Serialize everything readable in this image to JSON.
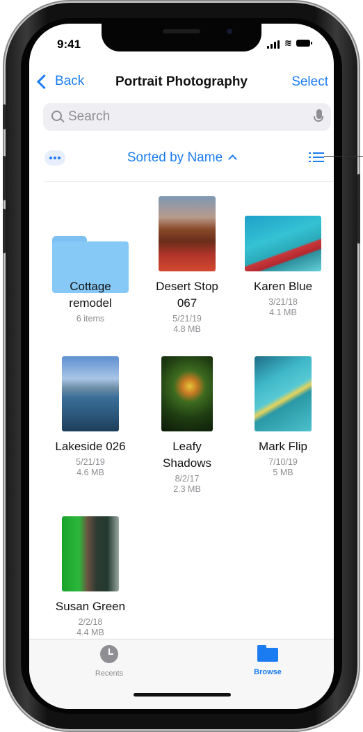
{
  "status_bar": {
    "time": "9:41"
  },
  "nav": {
    "back_label": "Back",
    "title": "Portrait Photography",
    "select_label": "Select"
  },
  "search": {
    "placeholder": "Search"
  },
  "sort": {
    "label": "Sorted by Name"
  },
  "items": [
    {
      "name": "Cottage\nremodel",
      "meta": "6 items"
    },
    {
      "name": "Desert Stop\n067",
      "meta": "5/21/19\n4.8 MB"
    },
    {
      "name": "Karen Blue",
      "meta": "3/21/18\n4.1 MB"
    },
    {
      "name": "Lakeside 026",
      "meta": "5/21/19\n4.6 MB"
    },
    {
      "name": "Leafy\nShadows",
      "meta": "8/2/17\n2.3 MB"
    },
    {
      "name": "Mark Flip",
      "meta": "7/10/19\n5 MB"
    },
    {
      "name": "Susan Green",
      "meta": "2/2/18\n4.4 MB"
    }
  ],
  "tabbar": {
    "recents_label": "Recents",
    "browse_label": "Browse",
    "active": "Browse"
  },
  "colors": {
    "accent": "#1b7cf2",
    "secondary_text": "#8e8e93",
    "folder": "#86c9f6"
  },
  "icons": [
    "back-chevron-icon",
    "search-icon",
    "microphone-icon",
    "more-icon",
    "sort-caret-icon",
    "list-view-icon",
    "folder-icon",
    "clock-icon",
    "browse-folder-icon"
  ]
}
